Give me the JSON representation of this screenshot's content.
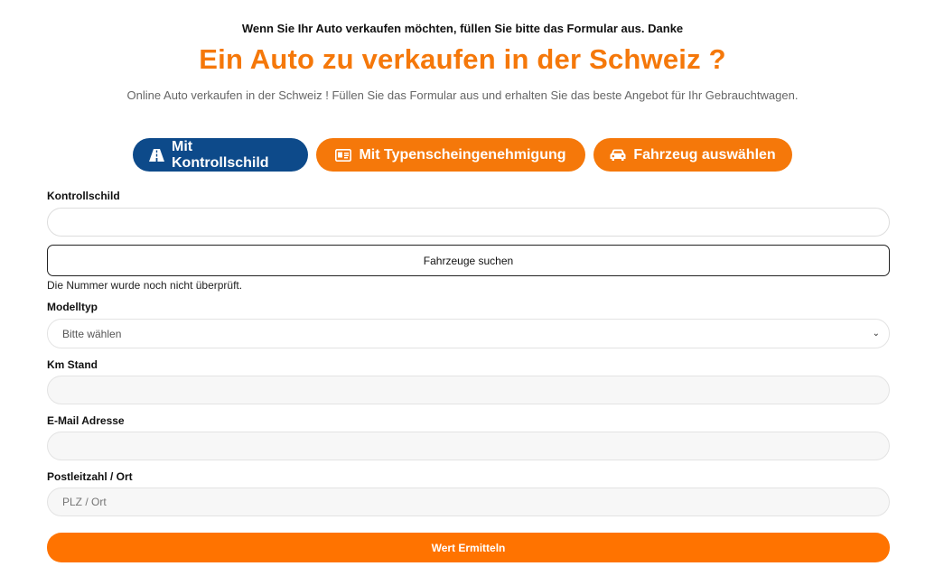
{
  "intro": "Wenn Sie Ihr Auto verkaufen möchten, füllen Sie bitte das Formular aus. Danke",
  "title": "Ein Auto zu verkaufen in der Schweiz ?",
  "subtitle": "Online Auto verkaufen in der Schweiz ! Füllen Sie das Formular aus und erhalten Sie das beste Angebot für Ihr Gebrauchtwagen.",
  "tabs": [
    {
      "label": "Mit Kontrollschild",
      "icon": "road-icon",
      "active": true
    },
    {
      "label": "Mit Typenscheingenehmigung",
      "icon": "id-card-icon",
      "active": false
    },
    {
      "label": "Fahrzeug auswählen",
      "icon": "car-icon",
      "active": false
    }
  ],
  "form": {
    "plate_label": "Kontrollschild",
    "plate_value": "",
    "search_button": "Fahrzeuge suchen",
    "status_text": "Die Nummer wurde noch nicht überprüft.",
    "model_label": "Modelltyp",
    "model_selected": "Bitte wählen",
    "km_label": "Km Stand",
    "km_value": "",
    "email_label": "E-Mail Adresse",
    "email_value": "",
    "zip_label": "Postleitzahl / Ort",
    "zip_placeholder": "PLZ / Ort",
    "submit_button": "Wert Ermitteln"
  },
  "colors": {
    "accent": "#f5780a",
    "submit": "#ff7300",
    "active_tab": "#0d4a8a"
  }
}
